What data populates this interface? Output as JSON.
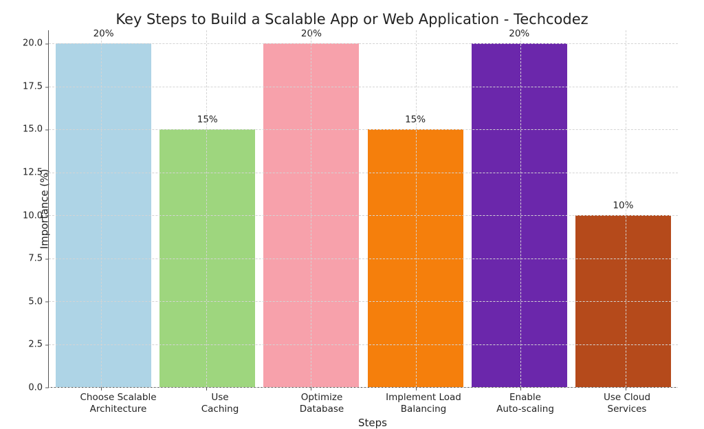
{
  "chart_data": {
    "type": "bar",
    "title": "Key Steps to Build a Scalable App or Web Application - Techcodez",
    "xlabel": "Steps",
    "ylabel": "Importance (%)",
    "ylim": [
      0,
      20
    ],
    "y_ticks": [
      0.0,
      2.5,
      5.0,
      7.5,
      10.0,
      12.5,
      15.0,
      17.5,
      20.0
    ],
    "y_tick_labels": [
      "0.0",
      "2.5",
      "5.0",
      "7.5",
      "10.0",
      "12.5",
      "15.0",
      "17.5",
      "20.0"
    ],
    "categories": [
      "Choose Scalable\nArchitecture",
      "Use\nCaching",
      "Optimize\nDatabase",
      "Implement Load\nBalancing",
      "Enable\nAuto-scaling",
      "Use Cloud\nServices"
    ],
    "values": [
      20,
      15,
      20,
      15,
      20,
      10
    ],
    "value_labels": [
      "20%",
      "15%",
      "20%",
      "15%",
      "20%",
      "10%"
    ],
    "colors": [
      "#aed4e6",
      "#9ed67e",
      "#f7a1ab",
      "#f57f0c",
      "#6b27ab",
      "#b54a1b"
    ]
  }
}
